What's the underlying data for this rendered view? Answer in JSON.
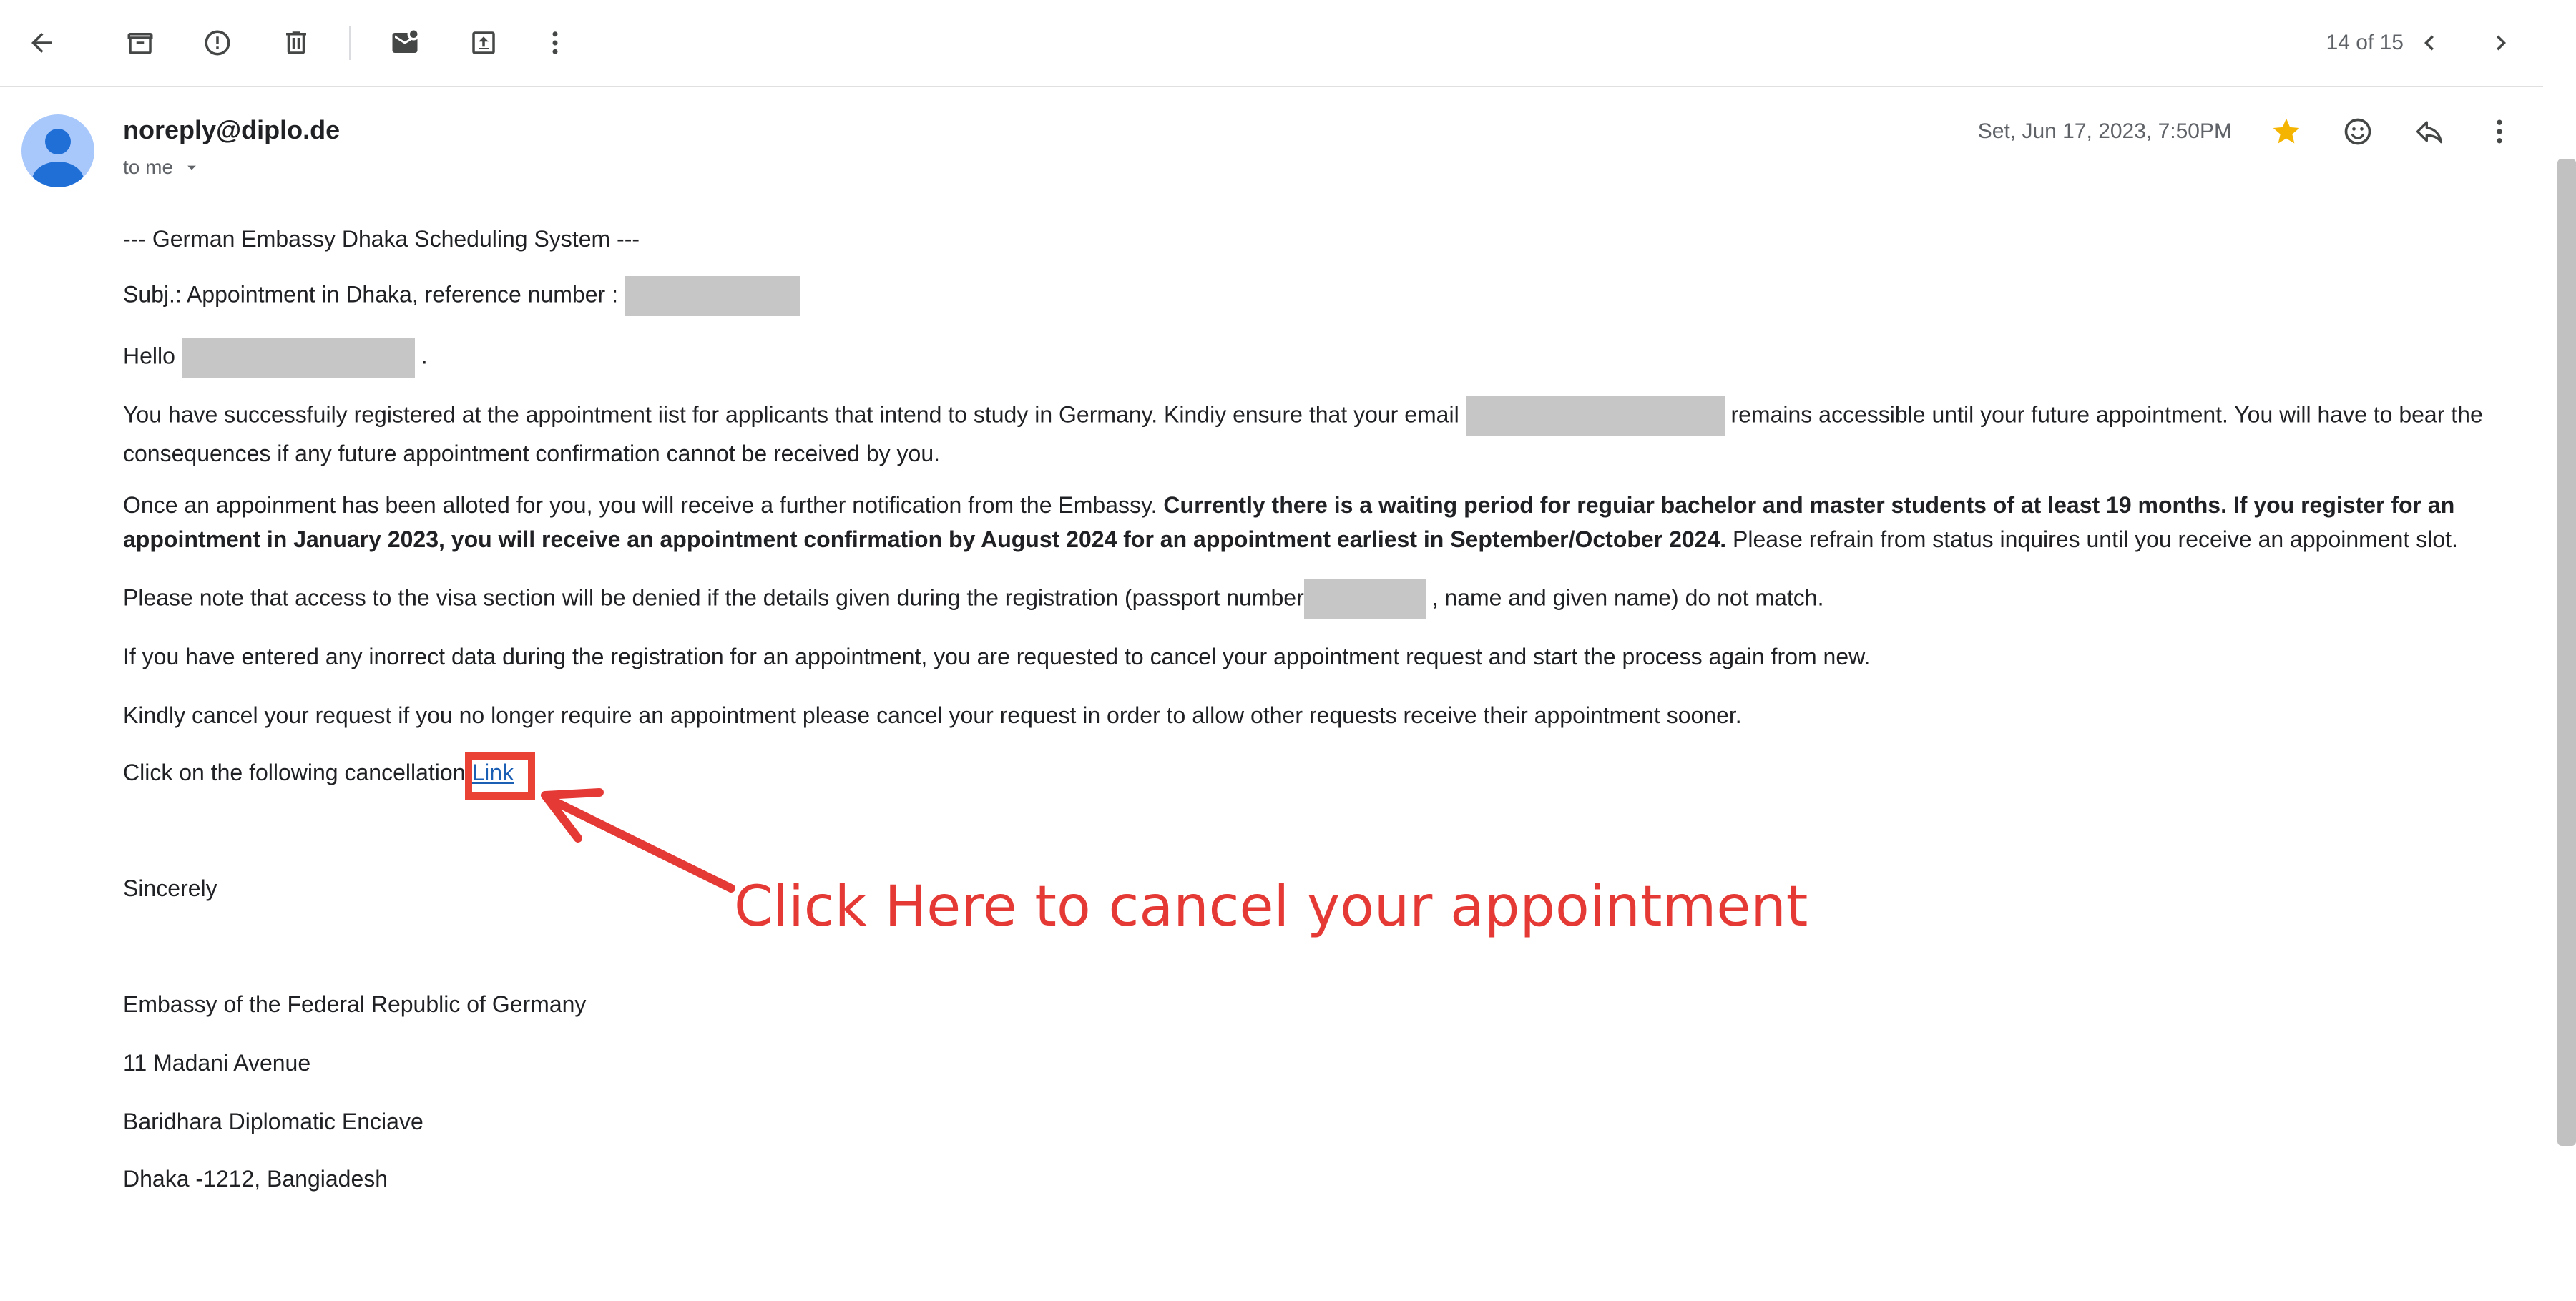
{
  "toolbar": {
    "back_icon": "arrow-left-icon",
    "archive_icon": "archive-icon",
    "spam_icon": "report-spam-icon",
    "delete_icon": "trash-icon",
    "mark_unread_icon": "mark-unread-icon",
    "move_icon": "move-to-icon",
    "more_icon": "more-vert-icon",
    "pager": "14 of 15",
    "prev_icon": "chevron-left-icon",
    "next_icon": "chevron-right-icon"
  },
  "header": {
    "sender": "noreply@diplo.de",
    "recipient": "to me",
    "date": "Set, Jun 17, 2023, 7:50PM",
    "star_icon": "star-icon",
    "star_color": "#f4b400",
    "emoji_icon": "emoji-icon",
    "reply_icon": "reply-icon",
    "more_icon": "more-vert-icon"
  },
  "body": {
    "system_line": "--- German Embassy Dhaka Scheduling System ---",
    "subject_line": "Subj.: Appointment in  Dhaka, reference number :",
    "hello": "Hello",
    "hello_end": ".",
    "p1_a": "You have successfuily registered at the appointment iist for applicants that intend to study in Germany. Kindiy ensure that your email",
    "p1_b": "remains accessible until your future appointment. You will have to bear the consequences if any future appointment confirmation cannot be received by you.",
    "p2_a": "Once an appoinment has been alloted for you, you will receive a further notification from the Embassy.",
    "p2_bold": "Currently there is a waiting period for reguiar bachelor and master students of at least 19 months. If you register for an appointment in January 2023, you will receive an appointment confirmation by August 2024 for an appointment earliest in September/October 2024.",
    "p2_c": "Please refrain from status inquires until you receive an appoinment slot.",
    "p3_a": "Please note that access to the visa section will be denied if the details given during the registration (passport number",
    "p3_b": ", name and given name) do not match.",
    "p4": "If you have entered any inorrect data during the registration for an appointment, you are requested to cancel your appointment request and start the process again from new.",
    "p5": "Kindly cancel your request if you no longer require an appointment please cancel your request in order to allow other requests receive their appointment sooner.",
    "p6": "Click on the following cancellation",
    "link": "Link",
    "sincerely": "Sincerely",
    "sig1": "Embassy of the Federal Republic of Germany",
    "sig2": "11 Madani Avenue",
    "sig3": "Baridhara Diplomatic Enciave",
    "sig4": "Dhaka -1212, Bangiadesh"
  },
  "annotation": {
    "text": "Click Here to cancel your appointment",
    "color": "#e53935"
  }
}
